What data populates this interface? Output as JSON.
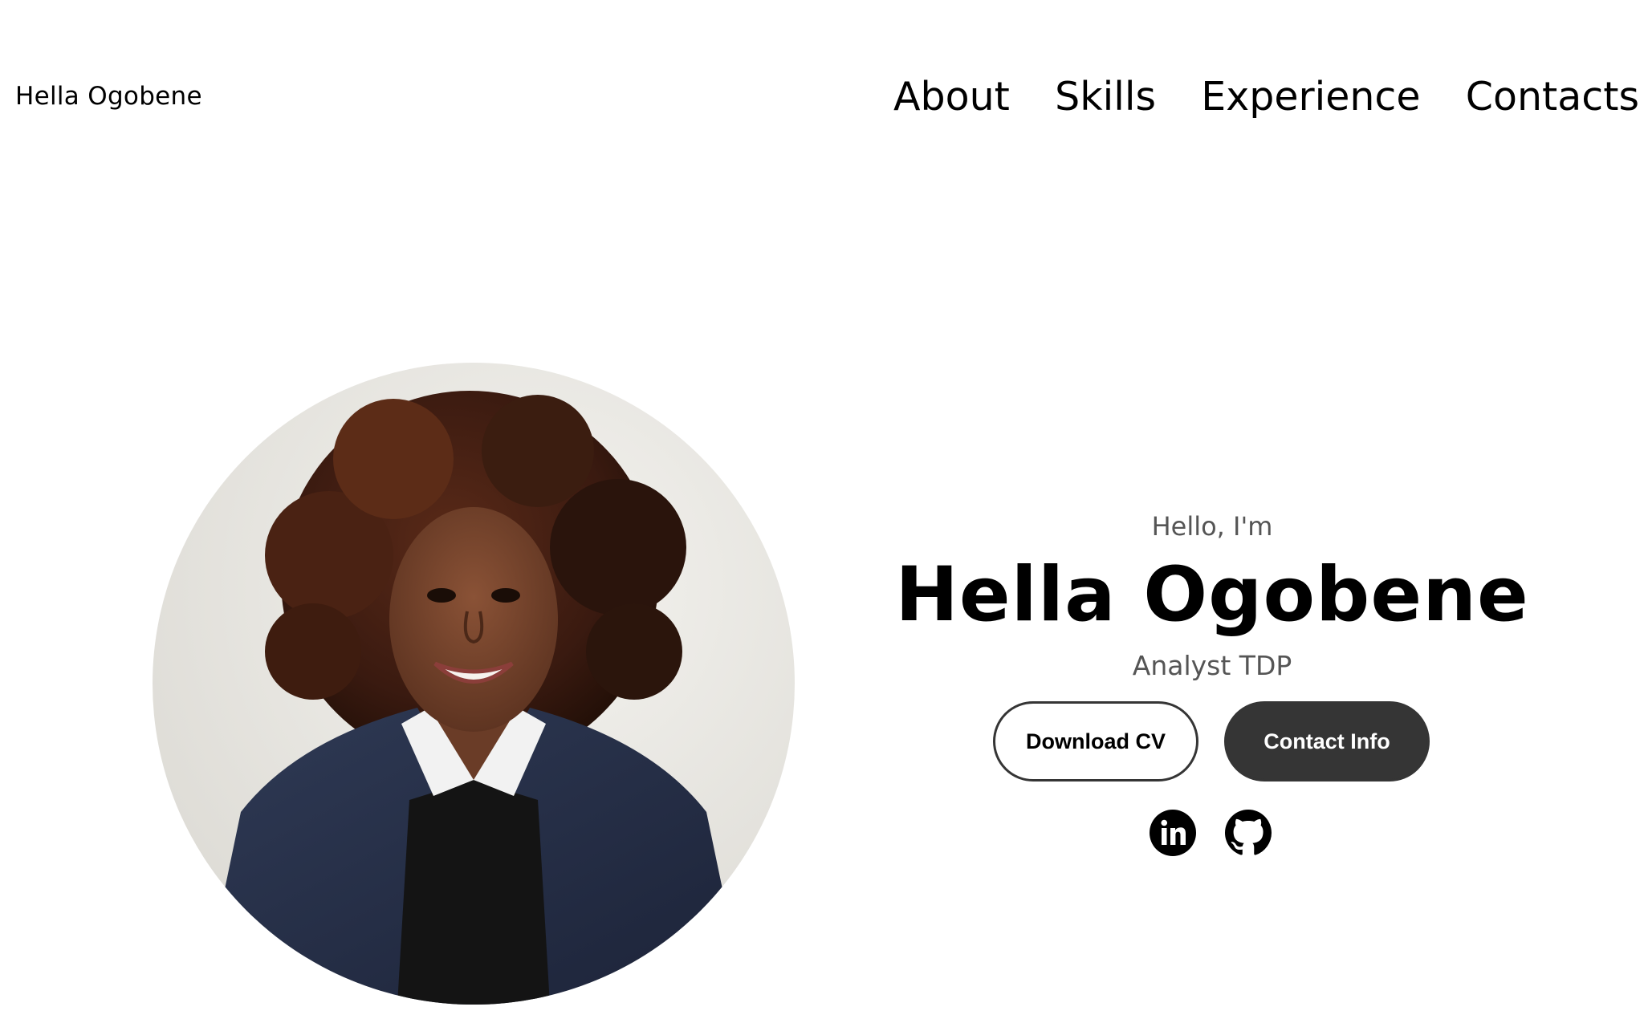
{
  "nav": {
    "logo": "Hella Ogobene",
    "links": [
      {
        "label": "About"
      },
      {
        "label": "Skills"
      },
      {
        "label": "Experience"
      },
      {
        "label": "Contacts"
      }
    ]
  },
  "hero": {
    "greeting": "Hello, I'm",
    "name": "Hella Ogobene",
    "role": "Analyst TDP",
    "buttons": {
      "download_cv": "Download CV",
      "contact_info": "Contact Info"
    },
    "socials": [
      {
        "icon": "linkedin-icon"
      },
      {
        "icon": "github-icon"
      }
    ],
    "profile_image_alt": "Profile picture"
  },
  "colors": {
    "text": "#000000",
    "muted_text": "#555555",
    "button_dark": "#353535",
    "background": "#ffffff"
  }
}
